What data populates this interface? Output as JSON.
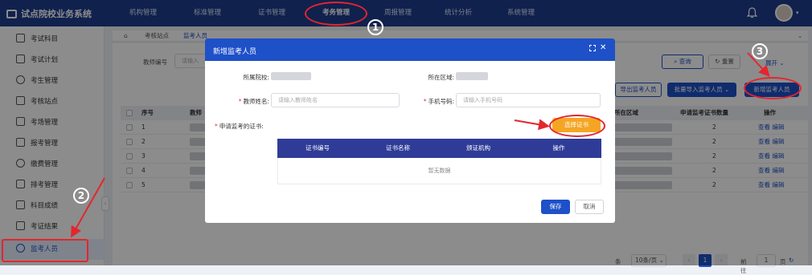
{
  "app": {
    "title": "试点院校业务系统"
  },
  "nav": [
    "机构管理",
    "标准管理",
    "证书管理",
    "考务管理",
    "周报管理",
    "统计分析",
    "系统管理"
  ],
  "sidebar": [
    "考试科目",
    "考试计划",
    "考生管理",
    "考核站点",
    "考场管理",
    "报考管理",
    "缴费管理",
    "排考管理",
    "科目成绩",
    "考证结果",
    "监考人员"
  ],
  "tabs": [
    "考核站点",
    "监考人员"
  ],
  "filter": {
    "teacher_no_label": "教师编号",
    "teacher_no_placeholder": "请输入",
    "search": "查询",
    "reset": "重置",
    "expand": "展开"
  },
  "actions": {
    "export": "导出监考人员",
    "batch_import": "批量导入监考人员",
    "add": "新增监考人员"
  },
  "table": {
    "headers": [
      "序号",
      "教师",
      "所在区域",
      "申请监考证书数量",
      "操作"
    ],
    "rows": [
      {
        "index": "1",
        "count": "2"
      },
      {
        "index": "2",
        "count": "2"
      },
      {
        "index": "3",
        "count": "2"
      },
      {
        "index": "4",
        "count": "2"
      },
      {
        "index": "5",
        "count": "2"
      }
    ],
    "op_view": "查看",
    "op_edit": "编辑"
  },
  "pager": {
    "page_size": "10条/页",
    "current": "1",
    "goto_label": "前往",
    "goto_value": "1",
    "page_unit": "页",
    "total_suffix": "条"
  },
  "modal": {
    "title": "新增监考人员",
    "school_label": "所属院校:",
    "region_label": "所在区域:",
    "teacher_name_label": "教师姓名:",
    "teacher_name_placeholder": "请输入教师姓名",
    "phone_label": "手机号码:",
    "phone_placeholder": "请输入手机号码",
    "cert_label": "申请监考的证书:",
    "select_cert": "选择证书",
    "cert_headers": [
      "证书编号",
      "证书名称",
      "颁证机构",
      "操作"
    ],
    "empty": "暂无数据",
    "save": "保存",
    "cancel": "取消"
  },
  "annotations": [
    "1",
    "2",
    "3"
  ],
  "colors": {
    "primary": "#1e50c8",
    "header": "#1e3d8f",
    "highlight": "#e3262d",
    "cert_button": "#f5a524"
  }
}
